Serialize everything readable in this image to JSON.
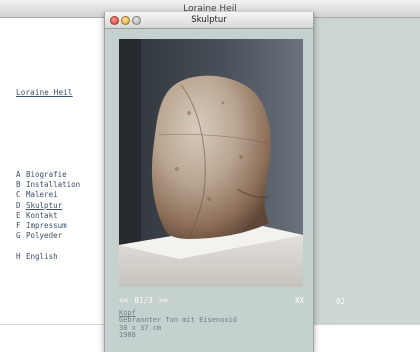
{
  "window": {
    "title": "Loraine Heil"
  },
  "sidebar": {
    "artist_name": "Loraine Heil",
    "nav": [
      {
        "letter": "A",
        "label": "Biografie",
        "active": false
      },
      {
        "letter": "B",
        "label": "Installation",
        "active": false
      },
      {
        "letter": "C",
        "label": "Malerei",
        "active": false
      },
      {
        "letter": "D",
        "label": "Skulptur",
        "active": true
      },
      {
        "letter": "E",
        "label": "Kontakt",
        "active": false
      },
      {
        "letter": "F",
        "label": "Impressum",
        "active": false
      },
      {
        "letter": "G",
        "label": "Polyeder",
        "active": false
      },
      {
        "letter": "H",
        "label": "English",
        "active": false
      }
    ]
  },
  "side_page_number": "02",
  "popup": {
    "title": "Skulptur",
    "pager": {
      "prev": "<<",
      "position": "01/3",
      "next": ">>",
      "close": "XX"
    },
    "caption": {
      "title": "Kopf",
      "material": "Gebrannter Ton mit Eisenoxid",
      "dimensions": "38 x 37 cm",
      "year": "1988"
    }
  },
  "colors": {
    "panel": "#c5d1cf",
    "right_column": "#cbd6d4",
    "link": "#3d4f66",
    "caption": "#6f7f86"
  }
}
